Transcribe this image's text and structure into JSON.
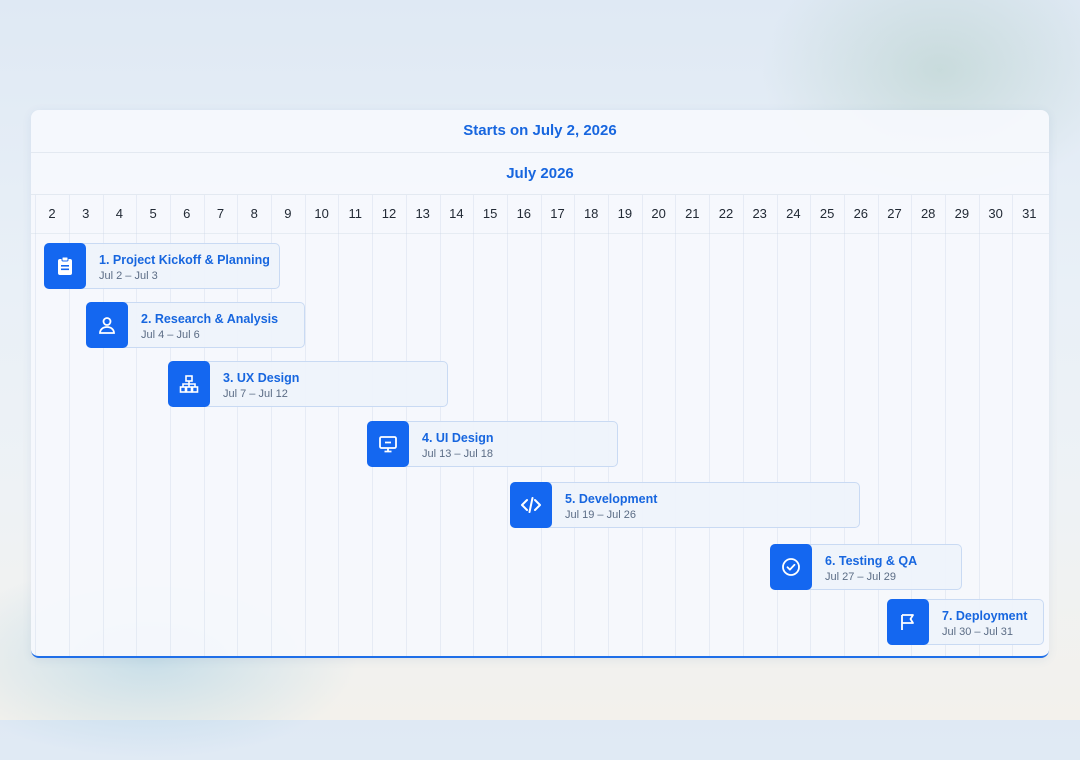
{
  "header": {
    "start_label": "Starts on July 2, 2026",
    "month_label": "July 2026"
  },
  "days": [
    "2",
    "3",
    "4",
    "5",
    "6",
    "7",
    "8",
    "9",
    "10",
    "11",
    "12",
    "13",
    "14",
    "15",
    "16",
    "17",
    "18",
    "19",
    "20",
    "21",
    "22",
    "23",
    "24",
    "25",
    "26",
    "27",
    "28",
    "29",
    "30",
    "31"
  ],
  "tasks": [
    {
      "title": "1. Project Kickoff & Planning",
      "dates": "Jul 2 – Jul 3",
      "icon": "clipboard-icon"
    },
    {
      "title": "2. Research & Analysis",
      "dates": "Jul 4 – Jul 6",
      "icon": "user-icon"
    },
    {
      "title": "3. UX Design",
      "dates": "Jul 7 – Jul 12",
      "icon": "sitemap-icon"
    },
    {
      "title": "4. UI Design",
      "dates": "Jul 13 – Jul 18",
      "icon": "monitor-icon"
    },
    {
      "title": "5. Development",
      "dates": "Jul 19 – Jul 26",
      "icon": "code-icon"
    },
    {
      "title": "6. Testing & QA",
      "dates": "Jul 27 – Jul 29",
      "icon": "check-circle-icon"
    },
    {
      "title": "7. Deployment",
      "dates": "Jul 30 – Jul 31",
      "icon": "flag-icon"
    }
  ],
  "colors": {
    "accent": "#1467f0",
    "title": "#1766df"
  }
}
